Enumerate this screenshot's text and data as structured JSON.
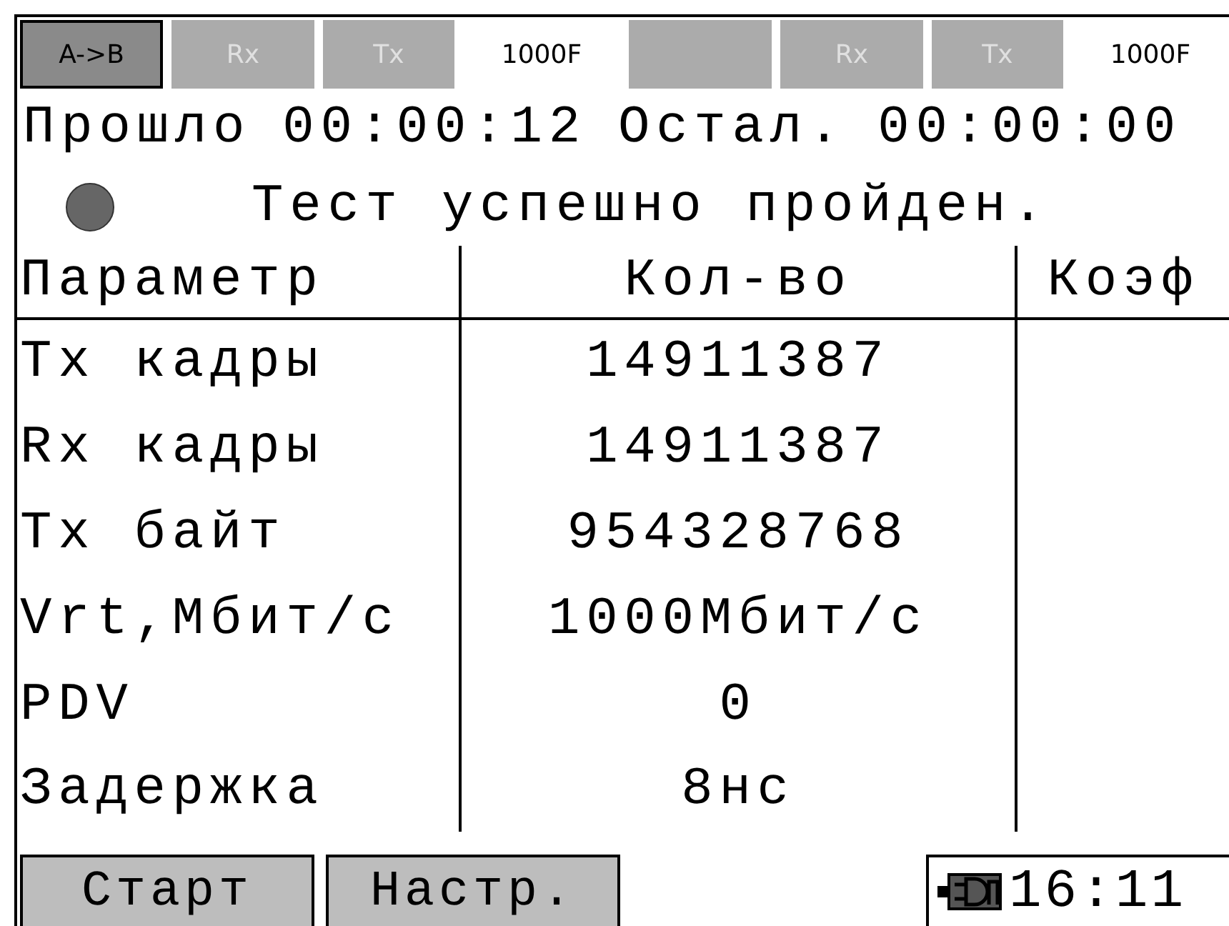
{
  "top_bar": [
    {
      "kind": "button",
      "label": "A->B",
      "selected": true
    },
    {
      "kind": "button",
      "label": "Rx",
      "selected": false
    },
    {
      "kind": "button",
      "label": "Tx",
      "selected": false
    },
    {
      "kind": "label",
      "label": "1000F"
    },
    {
      "kind": "button",
      "selected": false
    },
    {
      "kind": "button",
      "label": "Rx",
      "selected": false
    },
    {
      "kind": "button",
      "label": "Tx",
      "selected": false
    },
    {
      "kind": "label",
      "label": "1000F"
    }
  ],
  "timer": {
    "elapsed_label": "Прошло",
    "elapsed": "00:00:12",
    "remaining_label": "Остал.",
    "remaining": "00:00:00"
  },
  "status": {
    "message": "Тест успешно пройден."
  },
  "table": {
    "columns": [
      "Параметр",
      "Кол-во",
      "Коэф"
    ],
    "rows": [
      [
        "Tx кадры",
        "14911387",
        ""
      ],
      [
        "Rx кадры",
        "14911387",
        ""
      ],
      [
        "Tx байт",
        "954328768",
        ""
      ],
      [
        "Vrt,Мбит/с",
        "1000Мбит/с",
        ""
      ],
      [
        "PDV",
        "0",
        ""
      ],
      [
        "Задержка",
        "8нс",
        ""
      ]
    ]
  },
  "buttons": [
    "Старт",
    "Настр."
  ],
  "clock": "16:11"
}
